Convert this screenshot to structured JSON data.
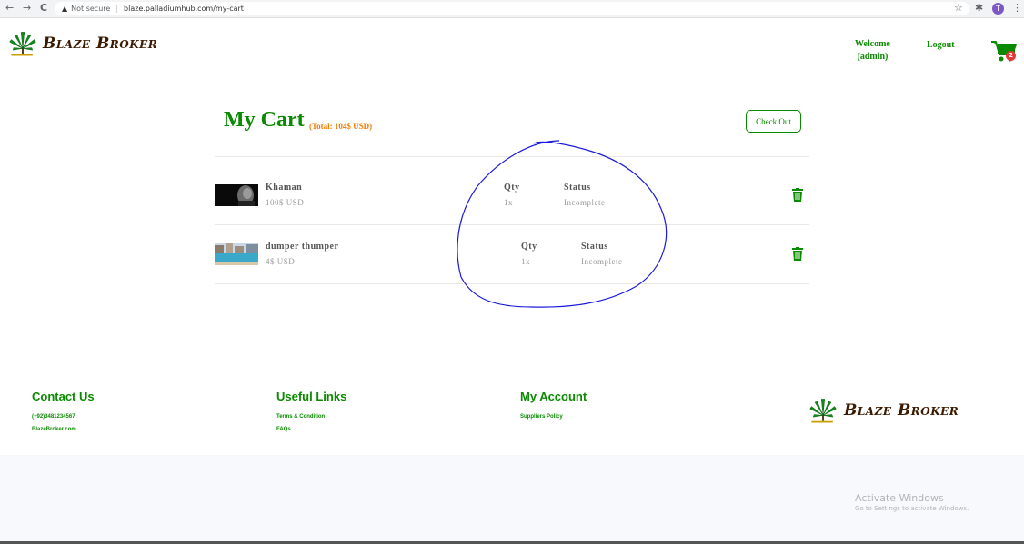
{
  "browser": {
    "back": "←",
    "forward": "→",
    "reload": "C",
    "security_label": "Not secure",
    "url": "blaze.palladiumhub.com/my-cart",
    "profile_initial": "T"
  },
  "header": {
    "brand": "Blaze Broker",
    "welcome_line1": "Welcome",
    "welcome_line2": "(admin)",
    "logout": "Logout",
    "cart_count": "2"
  },
  "cart": {
    "title": "My Cart",
    "total": "(Total: 104$ USD)",
    "checkout_label": "Check Out",
    "qty_label": "Qty",
    "status_label": "Status",
    "items": [
      {
        "name": "Khaman",
        "price": "100$ USD",
        "qty": "1x",
        "status": "Incomplete"
      },
      {
        "name": "dumper thumper",
        "price": "4$ USD",
        "qty": "1x",
        "status": "Incomplete"
      }
    ]
  },
  "footer": {
    "contact": {
      "heading": "Contact Us",
      "phone": "(+92)3481234567",
      "site": "BlazeBroker.com"
    },
    "links": {
      "heading": "Useful Links",
      "terms": "Terms & Condition",
      "faqs": "FAQs"
    },
    "account": {
      "heading": "My Account",
      "policy": "Suppliers Policy"
    },
    "brand": "Blaze Broker"
  },
  "os_overlay": {
    "line1": "Activate Windows",
    "line2": "Go to Settings to activate Windows."
  },
  "colors": {
    "brand_green": "#0a8a00",
    "total_orange": "#f57c00",
    "badge_red": "#e53935",
    "annotation_blue": "#1a1adb"
  }
}
